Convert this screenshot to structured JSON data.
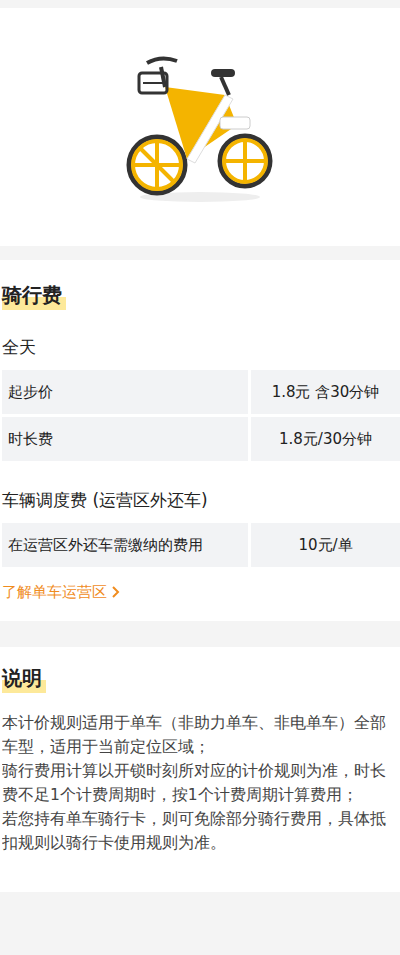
{
  "ride_fee": {
    "title": "骑行费",
    "period": "全天",
    "rows": [
      {
        "label": "起步价",
        "value": "1.8元 含30分钟"
      },
      {
        "label": "时长费",
        "value": "1.8元/30分钟"
      }
    ]
  },
  "dispatch_fee": {
    "title": "车辆调度费 (运营区外还车)",
    "rows": [
      {
        "label": "在运营区外还车需缴纳的费用",
        "value": "10元/单"
      }
    ],
    "link": "了解单车运营区"
  },
  "notes": {
    "title": "说明",
    "lines": [
      "本计价规则适用于单车（非助力单车、非电单车）全部",
      "车型，适用于当前定位区域；",
      "骑行费用计算以开锁时刻所对应的计价规则为准，时长",
      "费不足1个计费周期时，按1个计费周期计算费用；",
      "若您持有单车骑行卡，则可免除部分骑行费用，具体抵",
      "扣规则以骑行卡使用规则为准。"
    ]
  }
}
